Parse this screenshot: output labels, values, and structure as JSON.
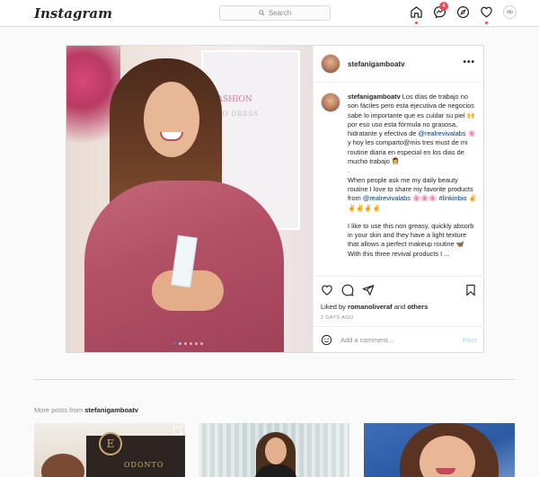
{
  "topbar": {
    "logo": "Instagram",
    "search_placeholder": "Search",
    "messages_badge": "4",
    "profile_avatar_text": "ölü"
  },
  "post": {
    "username": "stefanigamboatv",
    "more_label": "•••",
    "caption": {
      "username": "stefanigamboatv",
      "para1_a": " Los días de trabajo no son fáciles pero esta ejecutiva de negocios sabe lo importante que es cuidar su piel 🙌 por eso uso esta fórmula no grasosa, hidratante y efectiva de ",
      "tag1": "@realrevivalabs",
      "para1_b": " 🌸 y hoy les comparto@mis tres must de mi routine diaria en especial en los dias de mucho trabajo 👩‍💼",
      "dot": ".",
      "para2_a": "When people ask me my daily beauty routine I love to share my favorite products from ",
      "tag2": "@realrevivalabs",
      "para2_b": " 🌸🌸🌸 ",
      "tag3": "#linkinbio",
      "para2_c": " ✌✌✌✌✌",
      "para3": "I like to use this non greasy, quickly absorb in your skin and they have a light texture that allows a perfect makeup routine 🦋",
      "para4": "With this three revival products I ..."
    },
    "liked_by_prefix": "Liked by ",
    "liked_by_user": "romanoliveraf",
    "liked_by_and": " and ",
    "liked_by_others": "others",
    "date": "2 DAYS AGO",
    "comment_placeholder": "Add a comment...",
    "post_button": "Post",
    "carousel_count": 6,
    "carousel_active": 0
  },
  "photo": {
    "frame_text": "FASHION",
    "frame_subtext": "TO DRESS"
  },
  "more_posts": {
    "prefix": "More posts from ",
    "username": "stefanigamboatv"
  },
  "thumbs": {
    "t1_logo": "E",
    "t1_sign": "ODONTO"
  },
  "colors": {
    "link": "#00376b",
    "accent": "#0095f6",
    "badge": "#ed4956"
  }
}
